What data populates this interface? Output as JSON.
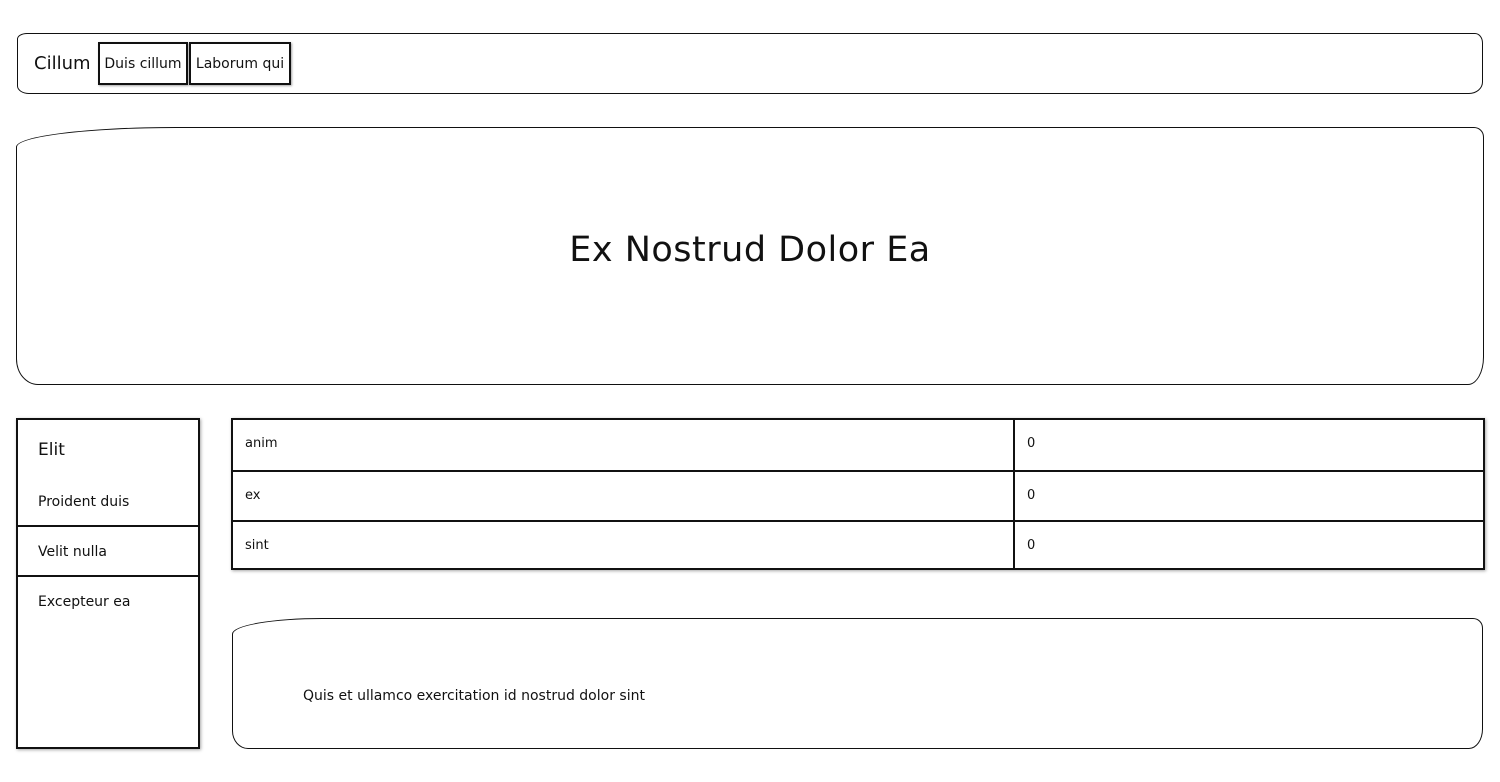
{
  "navbar": {
    "brand": "Cillum",
    "buttons": [
      "Duis cillum",
      "Laborum qui"
    ]
  },
  "hero": {
    "title": "Ex Nostrud Dolor Ea"
  },
  "sidebar": {
    "heading": "Elit",
    "items": [
      "Proident duis",
      "Velit nulla",
      "Excepteur ea"
    ]
  },
  "table": {
    "rows": [
      {
        "key": "anim",
        "value": "0"
      },
      {
        "key": "ex",
        "value": "0"
      },
      {
        "key": "sint",
        "value": "0"
      }
    ]
  },
  "card": {
    "text": "Quis et ullamco exercitation id nostrud dolor sint"
  }
}
